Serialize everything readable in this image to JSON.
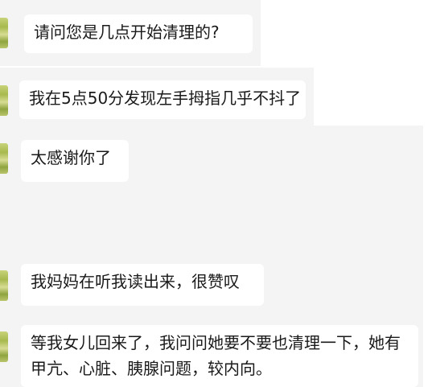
{
  "chat": {
    "messages": [
      {
        "text": "请问您是几点开始清理的?"
      },
      {
        "text": "我在5点50分发现左手拇指几乎不抖了"
      },
      {
        "text": "太感谢你了"
      },
      {
        "text": "我妈妈在听我读出来，很赞叹"
      },
      {
        "text": "等我女儿回来了，我问问她要不要也清理一下，她有甲亢、心脏、胰腺问题，较内向。"
      }
    ]
  }
}
